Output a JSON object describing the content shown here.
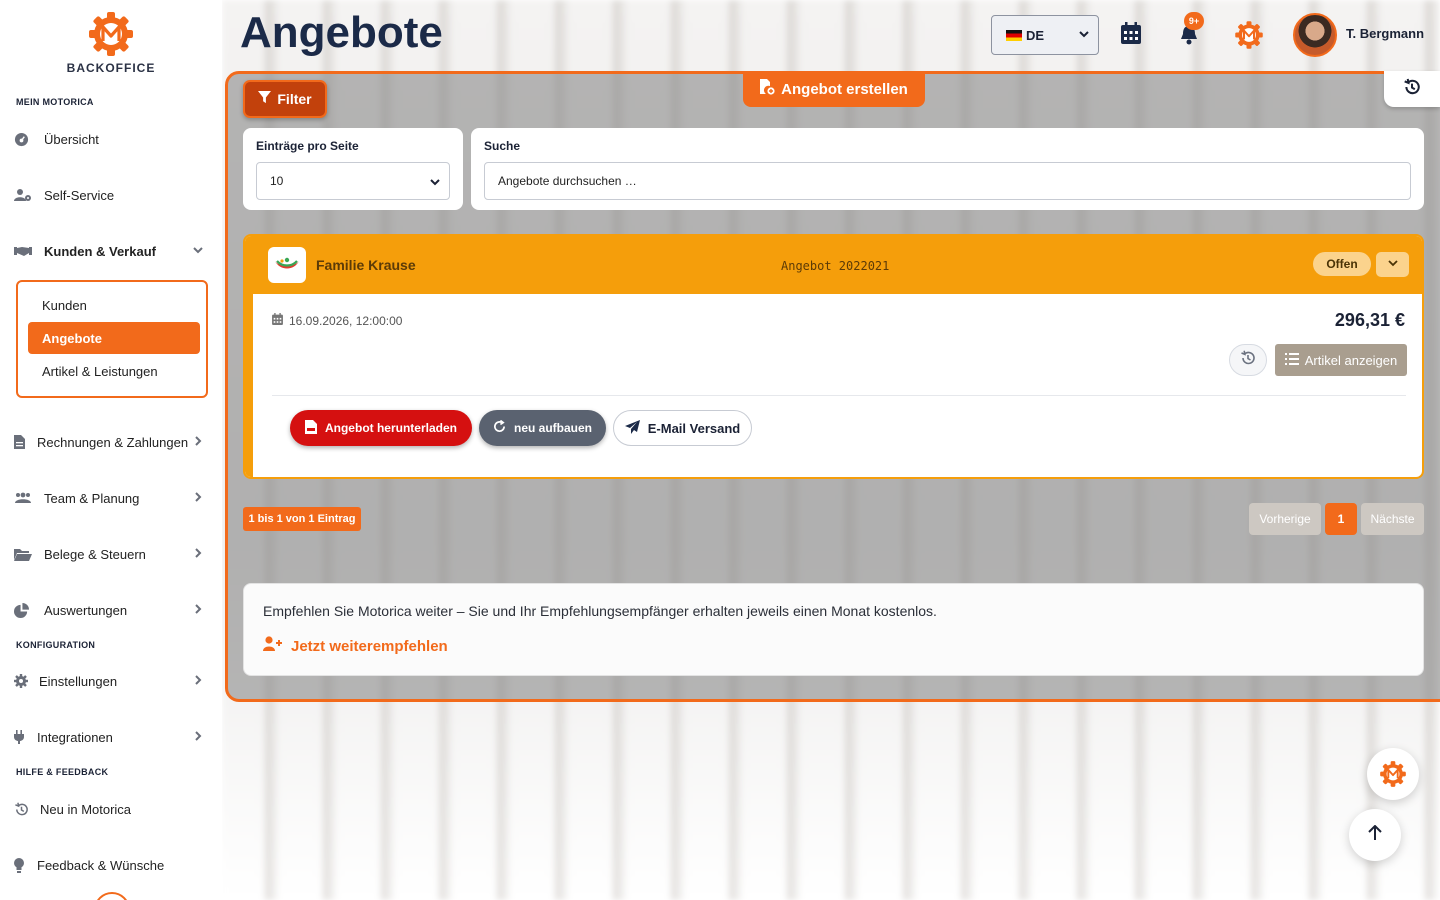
{
  "app": {
    "brand_label": "BACKOFFICE"
  },
  "sidebar": {
    "sections": {
      "mein": "MEIN MOTORICA",
      "konfig": "KONFIGURATION",
      "hilfe": "HILFE & FEEDBACK"
    },
    "items": {
      "uebersicht": "Übersicht",
      "selfservice": "Self-Service",
      "kunden_verkauf": "Kunden & Verkauf",
      "kunden": "Kunden",
      "angebote": "Angebote",
      "artikel": "Artikel & Leistungen",
      "rechnungen": "Rechnungen & Zahlungen",
      "team": "Team & Planung",
      "belege": "Belege & Steuern",
      "auswertungen": "Auswertungen",
      "einstellungen": "Einstellungen",
      "integrationen": "Integrationen",
      "neu": "Neu in Motorica",
      "feedback": "Feedback & Wünsche"
    }
  },
  "header": {
    "title": "Angebote",
    "language": "DE",
    "notification_badge": "9+",
    "user_name": "T. Bergmann"
  },
  "toolbar": {
    "filter_label": "Filter",
    "create_label": "Angebot erstellen"
  },
  "controls": {
    "per_page_label": "Einträge pro Seite",
    "per_page_value": "10",
    "search_label": "Suche",
    "search_placeholder": "Angebote durchsuchen …"
  },
  "offer": {
    "customer": "Familie Krause",
    "number": "Angebot 2022021",
    "status": "Offen",
    "date": "16.09.2026, 12:00:00",
    "price": "296,31 €",
    "articles_button": "Artikel anzeigen",
    "download_button": "Angebot herunterladen",
    "rebuild_button": "neu aufbauen",
    "email_button": "E-Mail Versand"
  },
  "pagination": {
    "info": "1 bis 1 von 1 Eintrag",
    "prev": "Vorherige",
    "current": "1",
    "next": "Nächste"
  },
  "recommend": {
    "text": "Empfehlen Sie Motorica weiter – Sie und Ihr Empfehlungsempfänger erhalten jeweils einen Monat kostenlos.",
    "link": "Jetzt weiterempfehlen"
  },
  "colors": {
    "accent": "#f26a1b",
    "offer_header": "#f59e0b",
    "navy": "#1b2a48",
    "danger": "#d51010"
  }
}
